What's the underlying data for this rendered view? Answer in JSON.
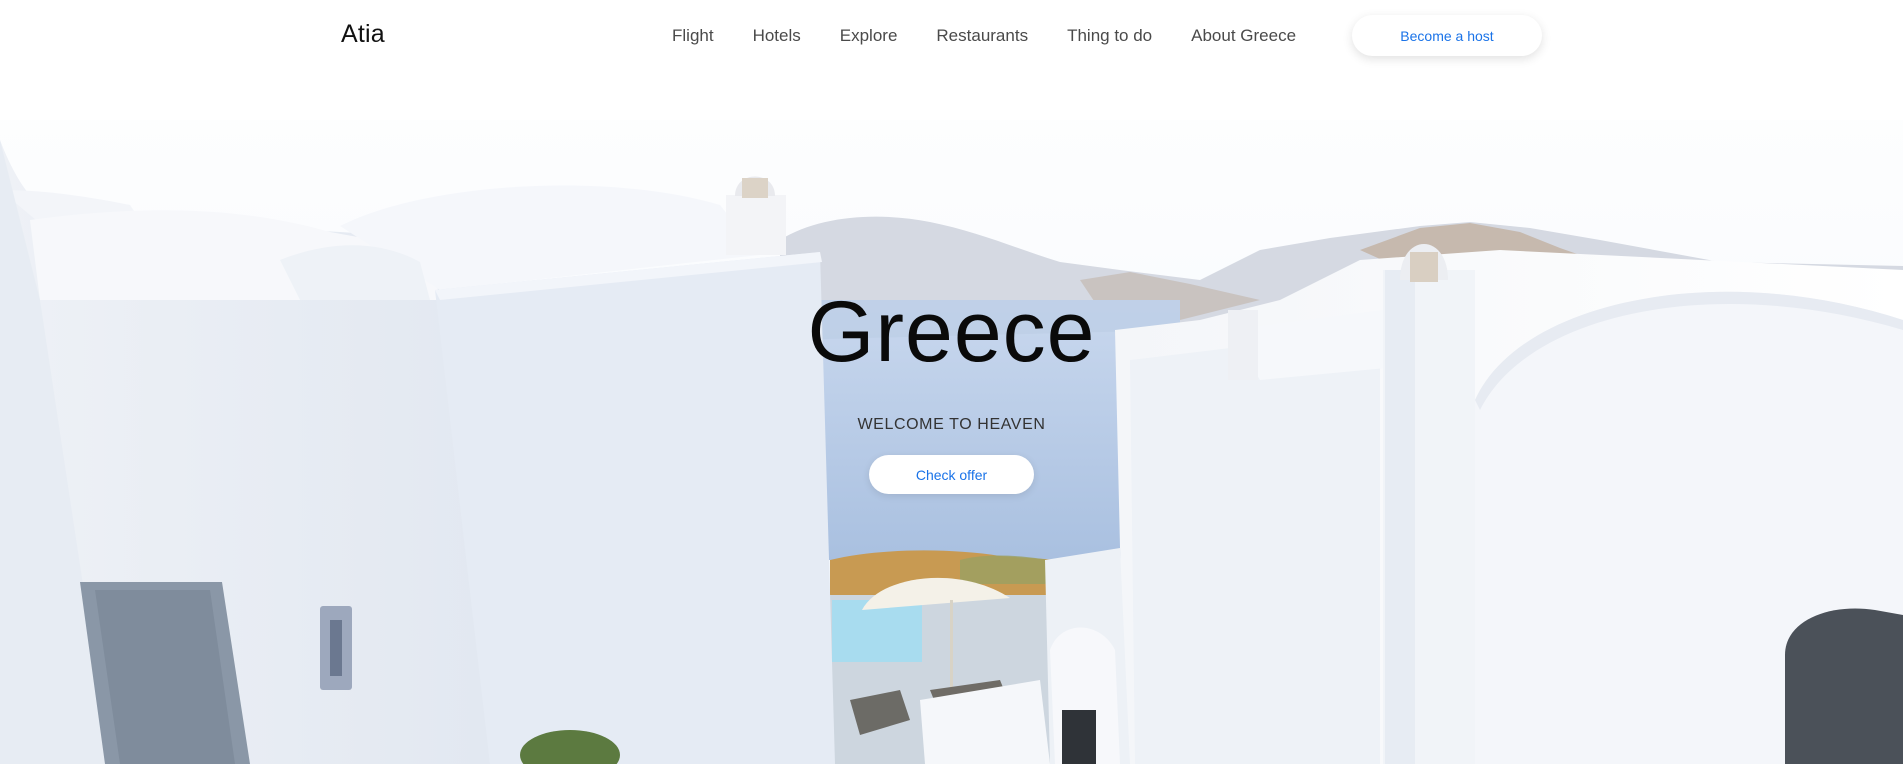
{
  "header": {
    "logo": "Atia",
    "nav": [
      {
        "label": "Flight"
      },
      {
        "label": "Hotels"
      },
      {
        "label": "Explore"
      },
      {
        "label": "Restaurants"
      },
      {
        "label": "Thing to do"
      },
      {
        "label": "About Greece"
      }
    ],
    "host_button": "Become a host"
  },
  "hero": {
    "title": "Greece",
    "subtitle": "WELCOME TO HEAVEN",
    "cta": "Check offer"
  },
  "colors": {
    "accent": "#1a73e8",
    "text_dark": "#0a0a0a",
    "nav_text": "#4a4a4a"
  }
}
